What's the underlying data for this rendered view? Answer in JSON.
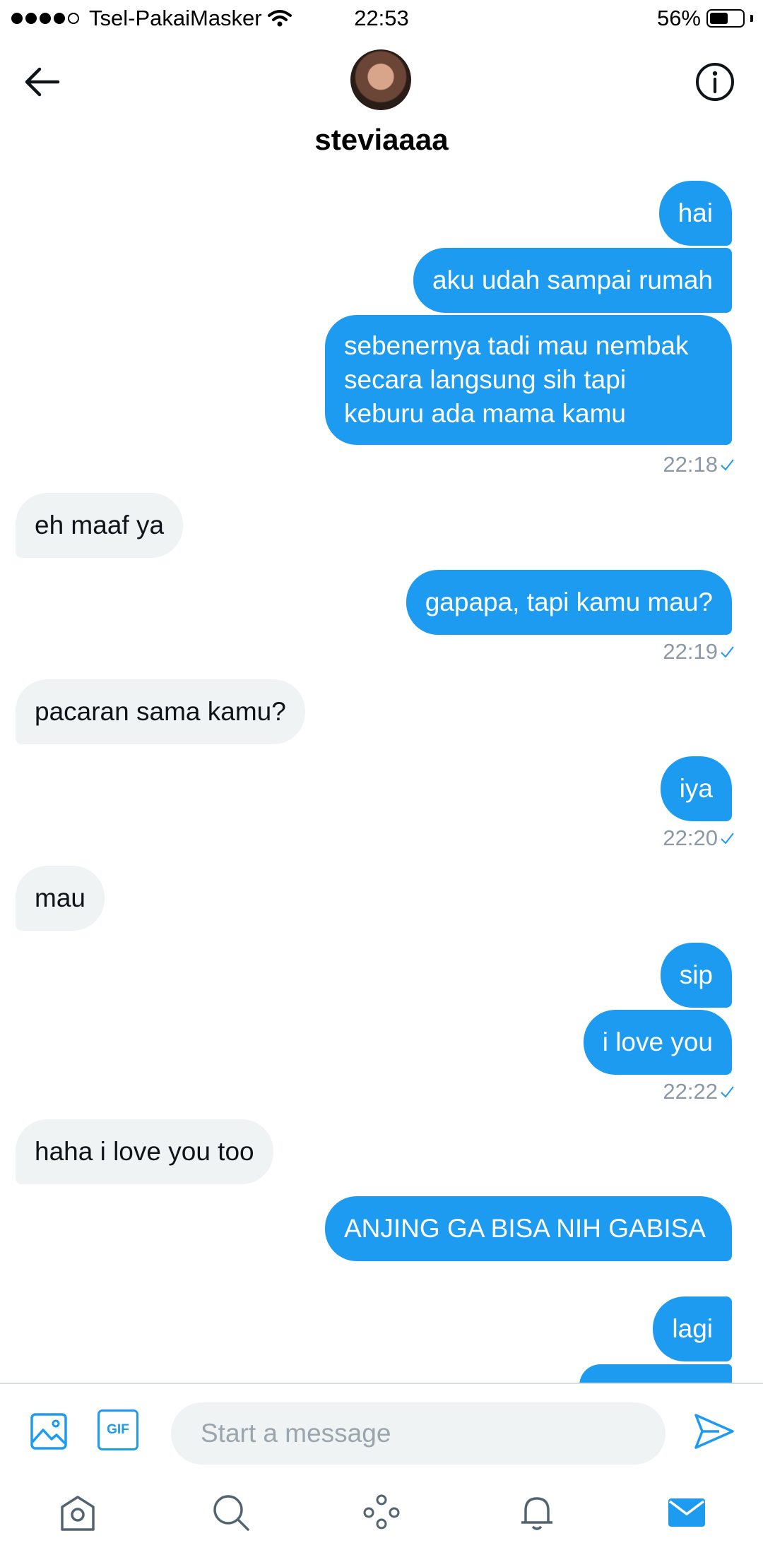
{
  "status_bar": {
    "carrier": "Tsel-PakaiMasker",
    "time": "22:53",
    "battery": "56%",
    "battery_level": 0.56
  },
  "header": {
    "title": "steviaaaa"
  },
  "messages": [
    {
      "text": "hai",
      "side": "out"
    },
    {
      "text": "aku udah sampai rumah",
      "side": "out"
    },
    {
      "text": "sebenernya tadi mau nembak secara langsung sih tapi keburu ada mama kamu",
      "side": "out"
    },
    {
      "time": "22:18"
    },
    {
      "text": "eh maaf ya",
      "side": "in"
    },
    {
      "text": "gapapa, tapi kamu mau?",
      "side": "out"
    },
    {
      "time": "22:19"
    },
    {
      "text": "pacaran sama kamu?",
      "side": "in"
    },
    {
      "text": "iya",
      "side": "out"
    },
    {
      "time": "22:20"
    },
    {
      "text": "mau",
      "side": "in"
    },
    {
      "text": "sip",
      "side": "out"
    },
    {
      "text": "i love you",
      "side": "out"
    },
    {
      "time": "22:22"
    },
    {
      "text": "haha i love you too",
      "side": "in"
    },
    {
      "text": "ANJING GA BISA NIH GABISA",
      "side": "out"
    },
    {
      "text": "lagi",
      "side": "out"
    }
  ],
  "composer": {
    "placeholder": "Start a message",
    "gif_label": "GIF"
  },
  "icons": {
    "back": "arrow-left-icon",
    "info": "info-icon",
    "image": "image-icon",
    "gif": "gif-icon",
    "send": "send-icon",
    "tabs": [
      "home-icon",
      "search-icon",
      "spaces-icon",
      "notifications-icon",
      "messages-icon"
    ]
  },
  "colors": {
    "accent": "#1d9bf0",
    "incoming_bubble": "#eff3f4",
    "timestamp": "#8b98a5"
  }
}
